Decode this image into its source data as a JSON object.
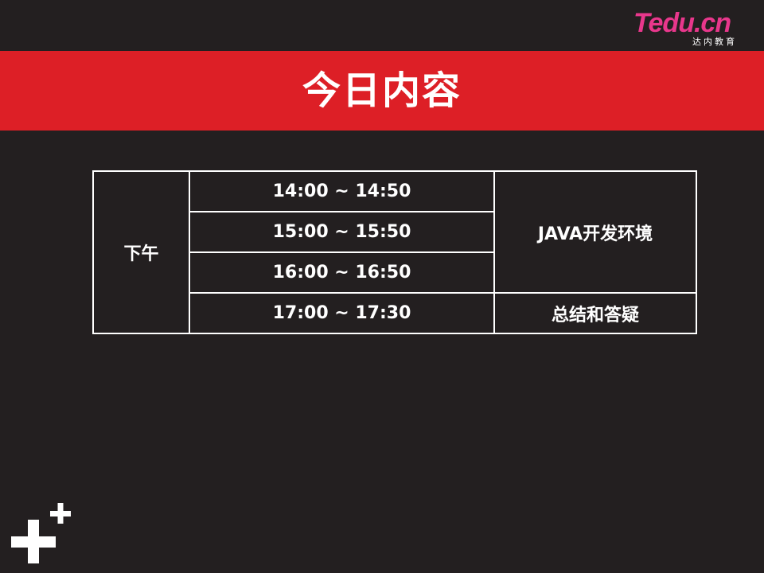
{
  "logo": {
    "main_part1": "T",
    "main_part2": "edu",
    "main_part3": ".cn",
    "sub": "达内教育"
  },
  "header": {
    "title": "今日内容"
  },
  "schedule": {
    "period": "下午",
    "rows": [
      {
        "time": "14:00 ~ 14:50"
      },
      {
        "time": "15:00 ~ 15:50"
      },
      {
        "time": "16:00 ~ 16:50"
      },
      {
        "time": "17:00 ~ 17:30"
      }
    ],
    "topics": [
      "JAVA开发环境",
      "总结和答疑"
    ]
  },
  "colors": {
    "background": "#231f20",
    "title_band": "#dd1f26",
    "logo_pink": "#e8378c",
    "text": "#ffffff"
  },
  "icons": {
    "corner_mark": "plus-cross-icon"
  }
}
